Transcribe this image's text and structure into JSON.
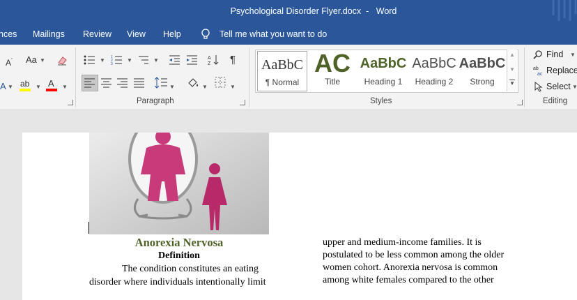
{
  "titlebar": {
    "document": "Psychological Disorder Flyer.docx",
    "app": "Word",
    "separator": "-"
  },
  "tabs": [
    "nces",
    "Mailings",
    "Review",
    "View",
    "Help"
  ],
  "tellme": "Tell me what you want to do",
  "font_group": {
    "case_label": "Aa"
  },
  "groups": {
    "paragraph": "Paragraph",
    "styles": "Styles",
    "editing": "Editing"
  },
  "styles": [
    {
      "sample": "AaBbC",
      "name": "¶ Normal"
    },
    {
      "sample": "AC",
      "name": "Title"
    },
    {
      "sample": "AaBbC",
      "name": "Heading 1"
    },
    {
      "sample": "AaBbC",
      "name": "Heading 2"
    },
    {
      "sample": "AaBbC",
      "name": "Strong"
    }
  ],
  "editing": {
    "find": "Find",
    "replace": "Replace",
    "select": "Select"
  },
  "colors": {
    "titlebar": "#2b579a",
    "heading": "#4f6228",
    "highlight": "#ffff00",
    "font_color": "#ff0000"
  },
  "document": {
    "heading": "Anorexia Nervosa",
    "subheading": "Definition",
    "left_lines": [
      "The condition constitutes an eating",
      "disorder where individuals intentionally limit"
    ],
    "right_lines": [
      "upper and medium-income families. It is",
      "postulated to be less common among the older",
      "women cohort. Anorexia nervosa is common",
      "among white females compared to the other"
    ]
  }
}
